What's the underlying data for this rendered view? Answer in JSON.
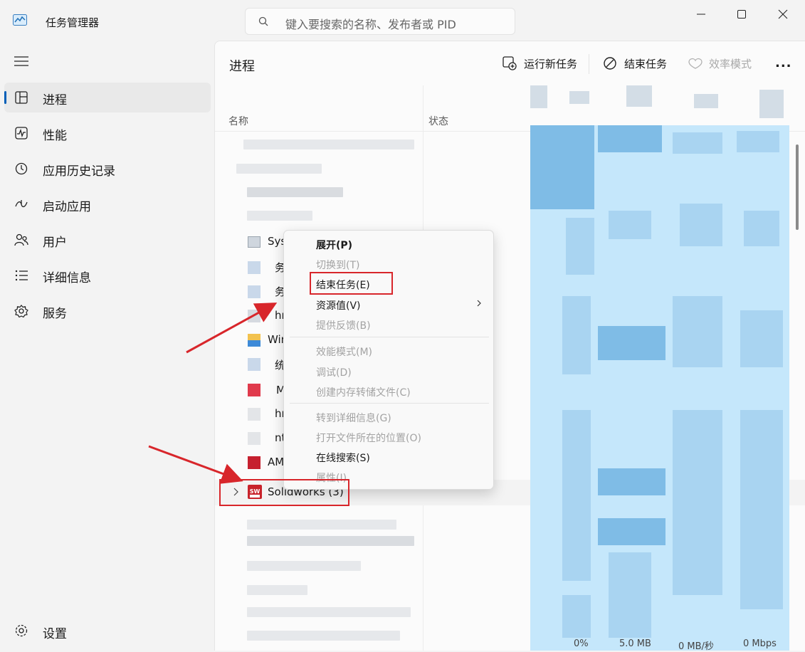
{
  "window": {
    "title": "任务管理器",
    "search_placeholder": "键入要搜索的名称、发布者或 PID"
  },
  "sidebar": {
    "items": [
      {
        "label": "进程",
        "icon": "processes-icon",
        "active": true
      },
      {
        "label": "性能",
        "icon": "performance-icon"
      },
      {
        "label": "应用历史记录",
        "icon": "app-history-icon"
      },
      {
        "label": "启动应用",
        "icon": "startup-apps-icon"
      },
      {
        "label": "用户",
        "icon": "users-icon"
      },
      {
        "label": "详细信息",
        "icon": "details-icon"
      },
      {
        "label": "服务",
        "icon": "services-icon"
      }
    ],
    "settings_label": "设置"
  },
  "toolbar": {
    "page_title": "进程",
    "run_new_task": "运行新任务",
    "end_task": "结束任务",
    "efficiency_mode": "效率模式",
    "more": "..."
  },
  "columns": {
    "name": "名称",
    "status": "状态"
  },
  "rows": {
    "partial": [
      "Sys",
      "务",
      "务",
      "hr",
      "Win",
      "统",
      "M",
      "hr",
      "nt",
      "AM"
    ],
    "solidworks": "Solidworks (3)"
  },
  "context_menu": {
    "items": [
      {
        "label": "展开(P)",
        "state": "bold"
      },
      {
        "label": "切换到(T)",
        "state": "disabled"
      },
      {
        "label": "结束任务(E)",
        "state": "enabled"
      },
      {
        "label": "资源值(V)",
        "state": "submenu"
      },
      {
        "label": "提供反馈(B)",
        "state": "disabled"
      },
      {
        "label": "效能模式(M)",
        "state": "disabled"
      },
      {
        "label": "调试(D)",
        "state": "disabled"
      },
      {
        "label": "创建内存转储文件(C)",
        "state": "disabled"
      },
      {
        "label": "转到详细信息(G)",
        "state": "disabled"
      },
      {
        "label": "打开文件所在的位置(O)",
        "state": "disabled"
      },
      {
        "label": "在线搜索(S)",
        "state": "enabled"
      },
      {
        "label": "属性(I)",
        "state": "disabled"
      }
    ]
  },
  "bottom_values": [
    "0%",
    "5.0 MB",
    "0 MB/秒",
    "0 Mbps"
  ],
  "colors": {
    "accent": "#005fb8",
    "annotation_red": "#d8262b",
    "highlight_blue": "#c5e7fb"
  }
}
